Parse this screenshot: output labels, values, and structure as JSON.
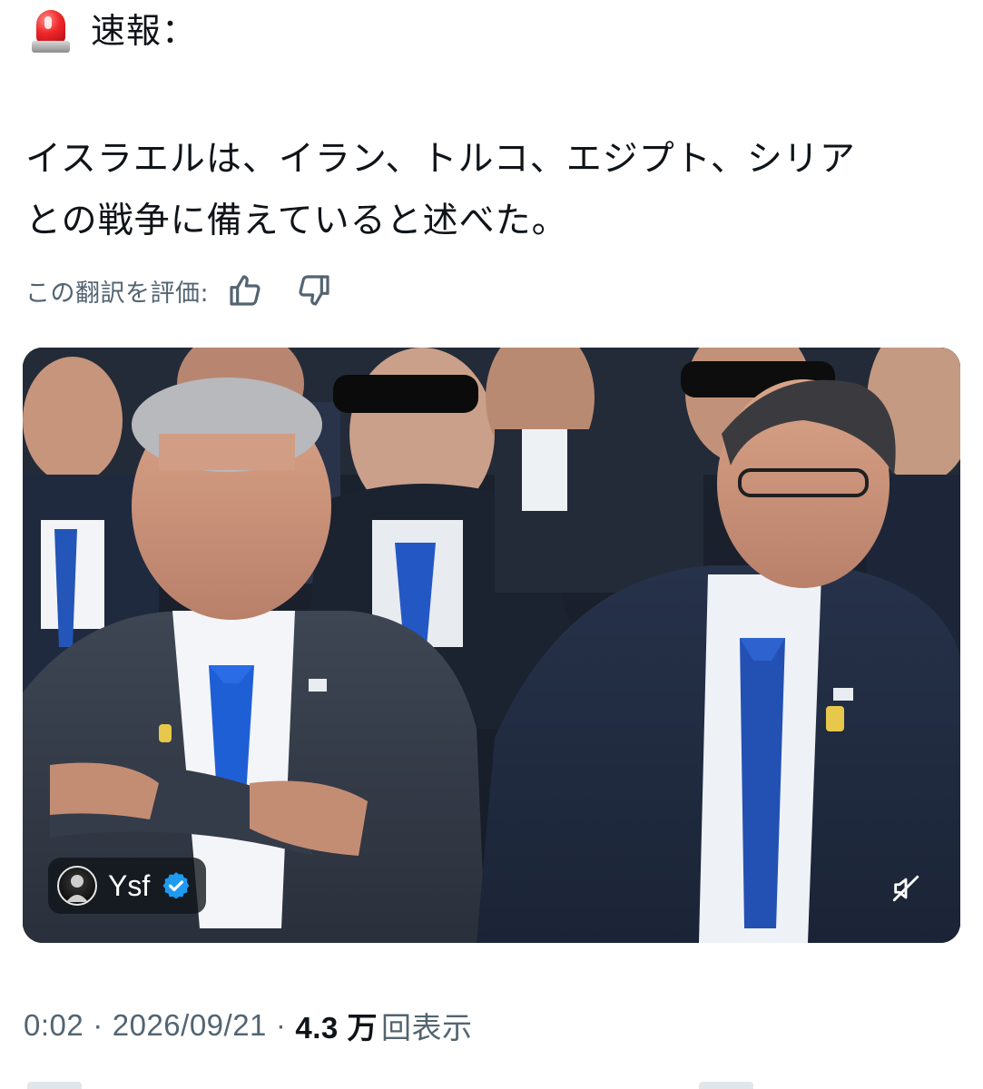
{
  "post": {
    "headline_icon": "police-siren-icon",
    "headline_label": "速報：",
    "body_lines": [
      "イスラエルは、イラン、トルコ、エジプト、シリア",
      "との戦争に備えていると述べた。"
    ],
    "translation_rating": {
      "label": "この翻訳を評価:",
      "up_icon": "thumbs-up-icon",
      "down_icon": "thumbs-down-icon"
    },
    "media": {
      "type": "video",
      "watermark_name": "Ysf",
      "verified_icon": "verified-badge-icon",
      "mute_icon": "speaker-muted-icon"
    },
    "meta": {
      "time": "0:02",
      "separator": "·",
      "date": "2026/09/21",
      "views_count": "4.3 万",
      "views_label": "回表示"
    }
  },
  "colors": {
    "text_primary": "#0f1419",
    "text_secondary": "#536471",
    "verified_blue": "#1d9bf0",
    "siren_red": "#f0282a"
  }
}
